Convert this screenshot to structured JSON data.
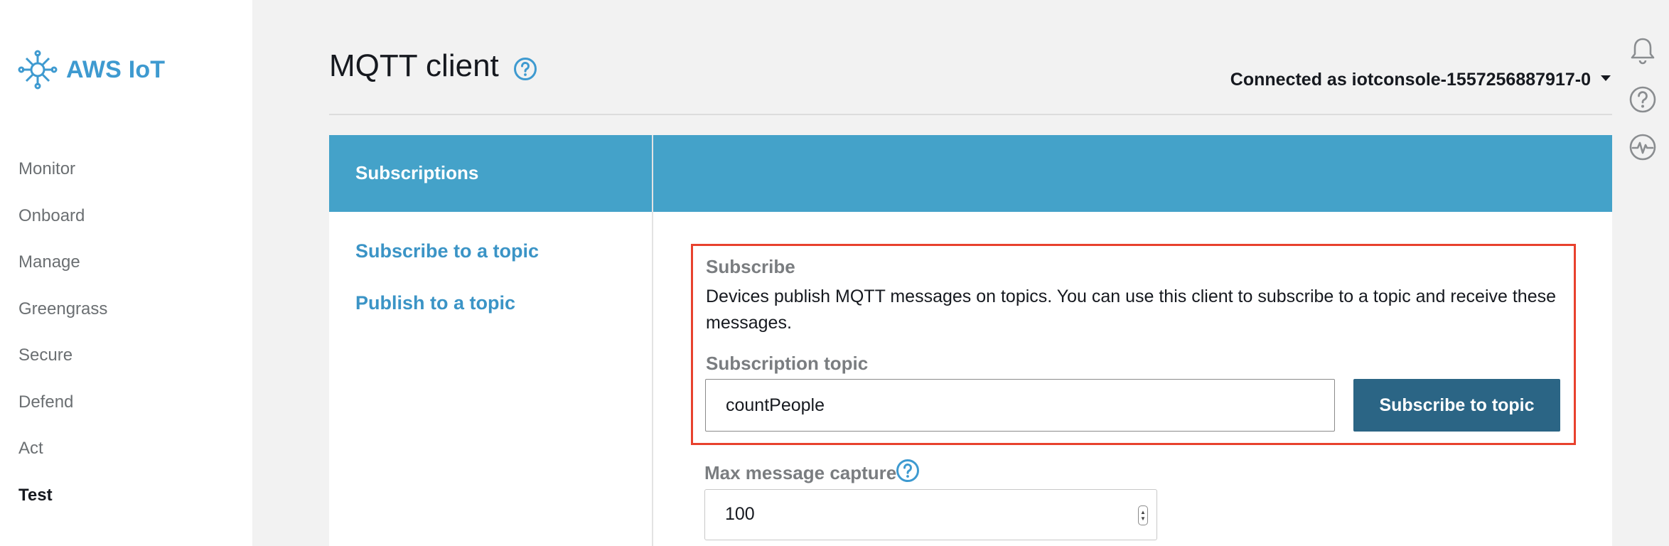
{
  "app": {
    "logo_text": "AWS IoT",
    "accent": "#3e9ad0"
  },
  "sidebar": {
    "items": [
      {
        "label": "Monitor"
      },
      {
        "label": "Onboard"
      },
      {
        "label": "Manage"
      },
      {
        "label": "Greengrass"
      },
      {
        "label": "Secure"
      },
      {
        "label": "Defend"
      },
      {
        "label": "Act"
      },
      {
        "label": "Test",
        "active": true
      }
    ]
  },
  "header": {
    "title": "MQTT client",
    "connected_label": "Connected as iotconsole-1557256887917-0"
  },
  "right_icons": [
    "bell-icon",
    "help-circle-icon",
    "activity-icon"
  ],
  "panel": {
    "header_title": "Subscriptions",
    "links": [
      {
        "label": "Subscribe to a topic"
      },
      {
        "label": "Publish to a topic"
      }
    ],
    "subscribe": {
      "heading": "Subscribe",
      "description": "Devices publish MQTT messages on topics. You can use this client to subscribe to a topic and receive these messages.",
      "topic_label": "Subscription topic",
      "topic_value": "countPeople",
      "button_label": "Subscribe to topic",
      "highlight_color": "#e8412d"
    },
    "max_capture": {
      "label": "Max message capture",
      "value": "100"
    }
  }
}
